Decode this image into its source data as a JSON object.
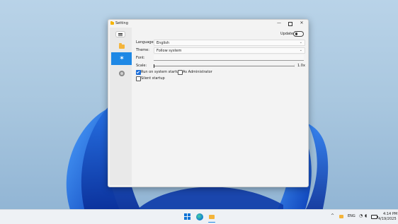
{
  "window": {
    "title": "Setting",
    "minimize_glyph": "—",
    "close_glyph": "✕"
  },
  "sidebar": {
    "items": [
      {
        "name": "menu",
        "icon": "hamburger-icon"
      },
      {
        "name": "general",
        "icon": "folder-icon"
      },
      {
        "name": "appearance",
        "icon": "theme-icon",
        "selected": true
      },
      {
        "name": "about",
        "icon": "info-icon"
      }
    ],
    "selected_color": "#1e88e5"
  },
  "settings": {
    "update_label": "Update",
    "update_enabled": false,
    "language_label": "Language:",
    "language_value": "English",
    "theme_label": "Theme:",
    "theme_value": "Follow system",
    "font_label": "Font:",
    "font_value": "",
    "scale_label": "Scale:",
    "scale_value": "1.0x",
    "run_on_startup_label": "Run on system startup",
    "run_on_startup_checked": true,
    "as_admin_label": "As Administrator",
    "as_admin_checked": false,
    "silent_startup_label": "Silent startup",
    "silent_startup_checked": false,
    "chevron_glyph": "⌄"
  },
  "taskbar": {
    "tray": {
      "overflow_glyph": "^",
      "language": "ENG",
      "time": "4:14 PM",
      "date": "4/19/2025"
    },
    "accent": "#1e88e5"
  }
}
